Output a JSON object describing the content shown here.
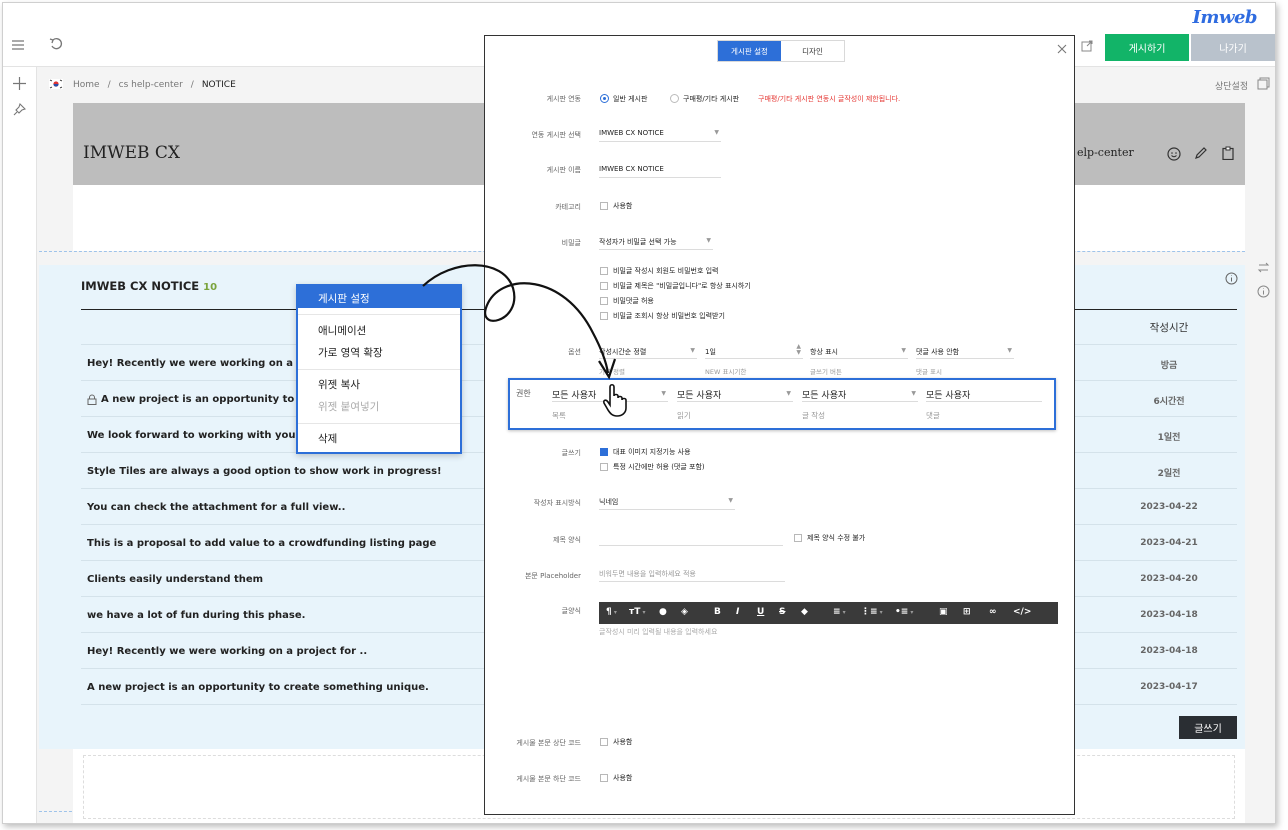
{
  "topbar": {
    "logo": "Imweb",
    "publish_label": "게시하기",
    "exit_label": "나가기"
  },
  "breadcrumb": {
    "home": "Home",
    "sep": "/",
    "section": "cs help-center",
    "current": "NOTICE"
  },
  "header_right": "상단설정",
  "banner": {
    "title": "IMWEB CX",
    "right_text": "elp-center"
  },
  "board": {
    "title": "IMWEB CX NOTICE",
    "count": "10",
    "col_time": "작성시간",
    "rows": [
      {
        "title": "Hey! Recently we were working on a proje",
        "date": "방금",
        "locked": false
      },
      {
        "title": "A new project is an opportunity to crea",
        "date": "6시간전",
        "locked": true
      },
      {
        "title": "We look forward to working with you on yo",
        "date": "1일전",
        "locked": false
      },
      {
        "title": "Style Tiles are always a good option to show work in progress!",
        "date": "2일전",
        "locked": false
      },
      {
        "title": "You can check the attachment for a full view..",
        "date": "2023-04-22",
        "locked": false
      },
      {
        "title": "This is a proposal to add value to a crowdfunding listing page",
        "date": "2023-04-21",
        "locked": false
      },
      {
        "title": "Clients easily understand them",
        "date": "2023-04-20",
        "locked": false
      },
      {
        "title": "we have a lot of fun during this phase.",
        "date": "2023-04-18",
        "locked": false
      },
      {
        "title": "Hey! Recently we were working on a project for ..",
        "date": "2023-04-18",
        "locked": false
      },
      {
        "title": "A new project is an opportunity to create something unique.",
        "date": "2023-04-17",
        "locked": false
      }
    ],
    "write_label": "글쓰기"
  },
  "context_menu": {
    "items": [
      "게시판 설정",
      "애니메이션",
      "가로 영역 확장",
      "위젯 복사",
      "위젯 붙여넣기",
      "삭제"
    ]
  },
  "modal": {
    "tabs": [
      "게시판 설정",
      "디자인"
    ],
    "link": {
      "label": "게시판 연동",
      "option1": "일반 게시판",
      "option2": "구매평/기타 게시판",
      "warning": "구매평/기타 게시판 연동시 글작성이 제한됩니다."
    },
    "linked_board": {
      "label": "연동 게시판 선택",
      "value": "IMWEB CX NOTICE"
    },
    "board_name": {
      "label": "게시판 이름",
      "value": "IMWEB CX NOTICE"
    },
    "category": {
      "label": "카테고리",
      "check": "사용함"
    },
    "secret": {
      "label": "비밀글",
      "value": "작성자가 비밀글 선택 가능",
      "checks": [
        "비밀글 작성시 회원도 비밀번호 입력",
        "비밀글 제목은 \"비밀글입니다\"로 항상 표시하기",
        "비밀댓글 허용",
        "비밀글 조회시 항상 비밀번호 입력받기"
      ]
    },
    "options": {
      "label": "옵션",
      "fields": [
        {
          "value": "작성시간순 정렬",
          "sub": "기본 정렬"
        },
        {
          "value": "1일",
          "sub": "NEW 표시기한"
        },
        {
          "value": "항상 표시",
          "sub": "글쓰기 버튼"
        },
        {
          "value": "댓글 사용 안함",
          "sub": "댓글 표시"
        }
      ]
    },
    "permission": {
      "label": "권한",
      "fields": [
        {
          "value": "모든 사용자",
          "sub": "목록"
        },
        {
          "value": "모든 사용자",
          "sub": "읽기"
        },
        {
          "value": "모든 사용자",
          "sub": "글 작성"
        },
        {
          "value": "모든 사용자",
          "sub": "댓글"
        }
      ]
    },
    "write": {
      "label": "글쓰기",
      "check1": "대표 이미지 지정기능 사용",
      "check2": "특정 시간에만 허용 (댓글 포함)"
    },
    "author_display": {
      "label": "작성자 표시방식",
      "value": "닉네임"
    },
    "title_form": {
      "label": "제목 양식",
      "check": "제목 양식 수정 불가"
    },
    "body_placeholder": {
      "label": "본문 Placeholder",
      "value": "비워두면 내용을 입력하세요 적용"
    },
    "template": {
      "label": "글양식",
      "placeholder": "글작성시 미리 입력될 내용을 입력하세요"
    },
    "top_code": {
      "label": "게시물 본문 상단 코드",
      "check": "사용함"
    },
    "bottom_code": {
      "label": "게시물 본문 하단 코드",
      "check": "사용함"
    }
  },
  "colors": {
    "accent": "#2d6fd8",
    "publish": "#12b468",
    "exit": "#b9c2cc",
    "warning": "#e53935",
    "board_bg": "#e8f4fb"
  }
}
